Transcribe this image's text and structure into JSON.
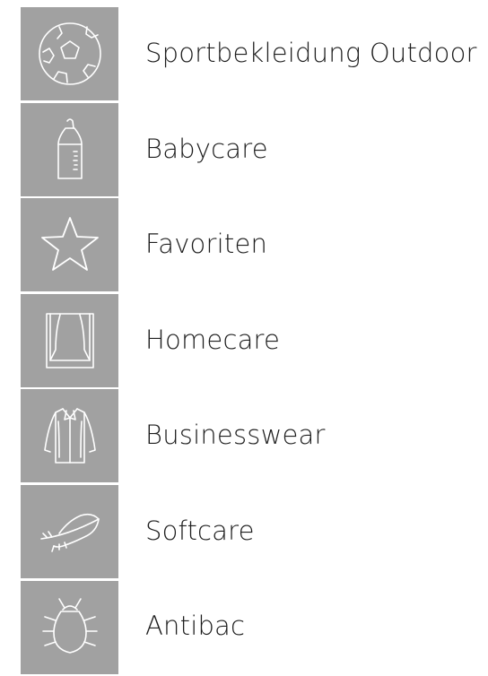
{
  "menu": {
    "items": [
      {
        "label": "Sportbekleidung Outdoor",
        "icon": "soccer-ball-icon"
      },
      {
        "label": "Babycare",
        "icon": "baby-bottle-icon"
      },
      {
        "label": "Favoriten",
        "icon": "star-icon"
      },
      {
        "label": "Homecare",
        "icon": "curtains-icon"
      },
      {
        "label": "Businesswear",
        "icon": "shirt-icon"
      },
      {
        "label": "Softcare",
        "icon": "feather-icon"
      },
      {
        "label": "Antibac",
        "icon": "bug-icon"
      }
    ]
  },
  "colors": {
    "tile_background": "#a1a1a1",
    "icon_stroke": "#ffffff",
    "label_text": "#1e1e1e"
  }
}
